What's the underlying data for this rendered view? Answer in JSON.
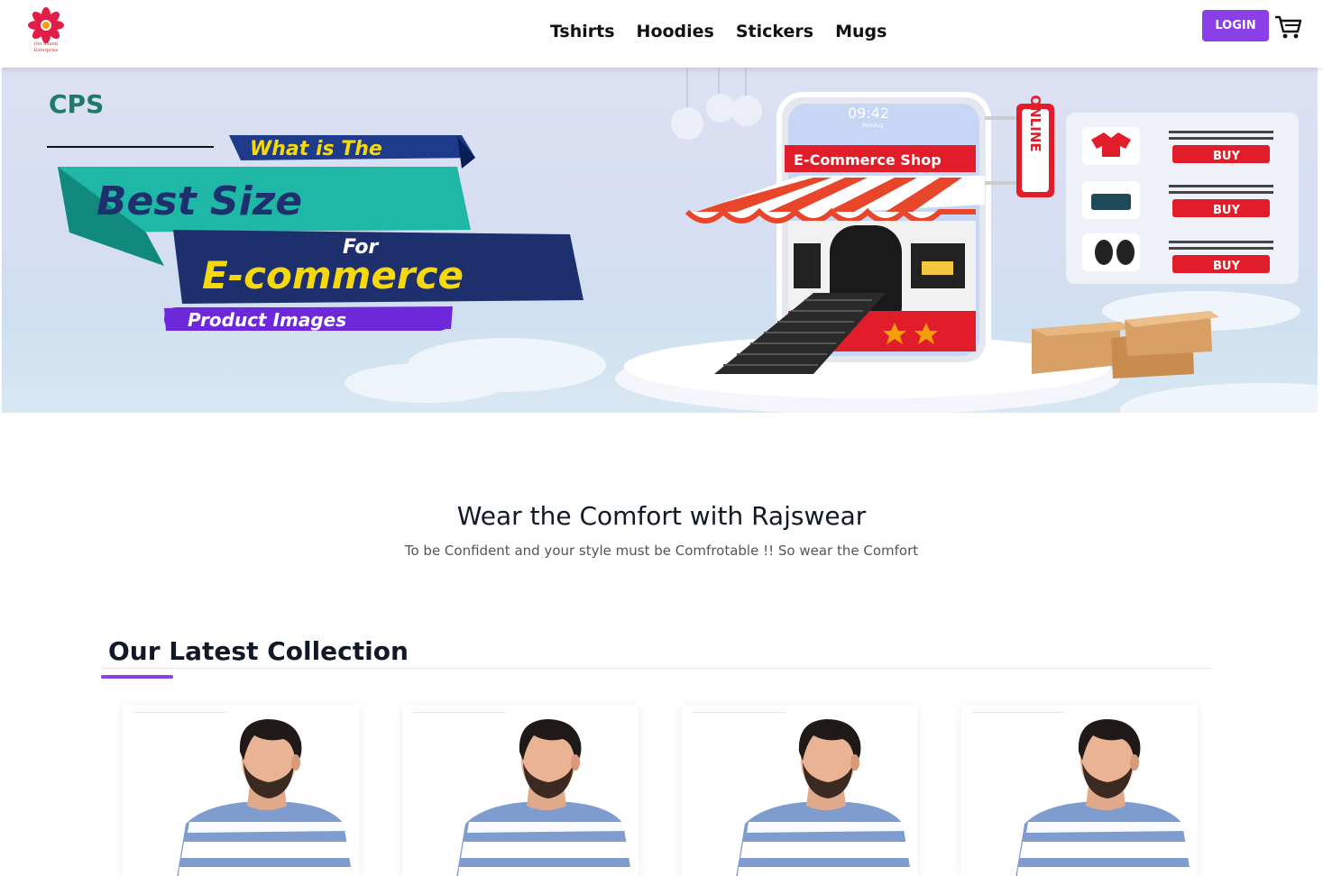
{
  "brand": {
    "logo_text": "Om Shanti Enterprise",
    "logo_icon": "flower-logo-icon"
  },
  "nav": {
    "links": [
      "Tshirts",
      "Hoodies",
      "Stickers",
      "Mugs"
    ],
    "login_label": "LOGIN",
    "cart_icon": "cart-icon"
  },
  "hero": {
    "badge": "CPS",
    "line1": "What is The",
    "line2": "Best Size",
    "line3": "For",
    "line4": "E-commerce",
    "line5": "Product Images",
    "phone_time": "09:42",
    "phone_day": "Monday",
    "shop_sign": "E-Commerce Shop",
    "online_sign": "ONLINE",
    "buy_label": "BUY"
  },
  "intro": {
    "title": "Wear the Comfort with Rajswear",
    "subtitle": "To be Confident and your style must be Comfrotable !! So wear the Comfort"
  },
  "collection": {
    "title": "Our Latest Collection",
    "cards": [
      {
        "image": "striped-tshirt-model"
      },
      {
        "image": "striped-tshirt-model"
      },
      {
        "image": "striped-tshirt-model"
      },
      {
        "image": "striped-tshirt-model"
      }
    ]
  },
  "colors": {
    "accent": "#8b3fe6",
    "hero_red": "#e11d2a",
    "hero_navy": "#1e2f6e",
    "hero_teal": "#1fb7a6",
    "hero_yellow": "#f5d90a"
  }
}
